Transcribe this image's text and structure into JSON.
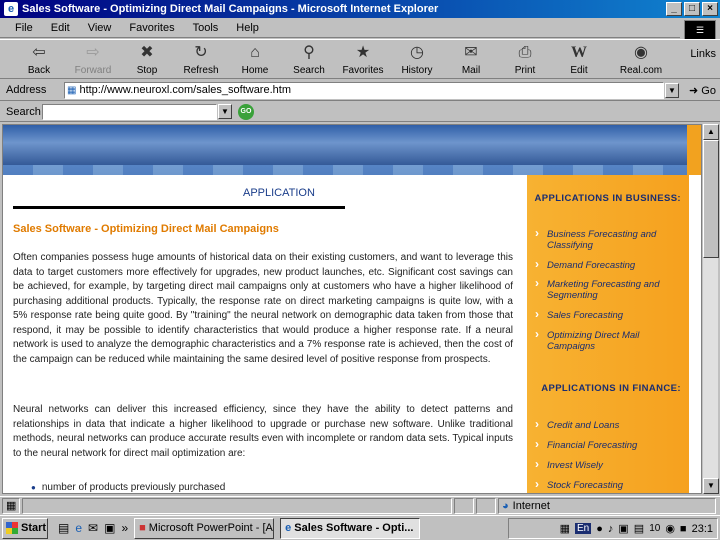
{
  "window": {
    "title": "Sales Software - Optimizing Direct Mail Campaigns - Microsoft Internet Explorer"
  },
  "menu": [
    "File",
    "Edit",
    "View",
    "Favorites",
    "Tools",
    "Help"
  ],
  "toolbar": {
    "back": "Back",
    "forward": "Forward",
    "stop": "Stop",
    "refresh": "Refresh",
    "home": "Home",
    "search": "Search",
    "favorites": "Favorites",
    "history": "History",
    "mail": "Mail",
    "print": "Print",
    "edit": "Edit",
    "realcom": "Real.com",
    "links": "Links"
  },
  "address": {
    "label": "Address",
    "url": "http://www.neuroxl.com/sales_software.htm",
    "go": "Go"
  },
  "searchbar": {
    "label": "Search",
    "go_badge": "GO"
  },
  "page": {
    "section_label": "APPLICATION",
    "heading": "Sales Software - Optimizing Direct Mail Campaigns",
    "p1": "Often companies possess huge amounts of historical data on their existing customers, and want to leverage this data to target customers more effectively for upgrades, new product launches, etc. Significant cost savings can be achieved, for example, by targeting direct mail campaigns only at customers who have a higher likelihood of purchasing additional products. Typically, the response rate on direct marketing campaigns is quite low, with a 5% response rate being quite good. By \"training\" the neural network on demographic data taken from those that respond, it may be possible to identify characteristics that would produce a higher response rate. If a neural network is used to analyze the demographic characteristics and a 7% response rate is achieved, then the cost of the campaign can be reduced while maintaining the same desired level of positive response from prospects.",
    "p2": "Neural networks can deliver this increased efficiency, since they have the ability to detect patterns and relationships in data that indicate a higher likelihood to upgrade or purchase new software. Unlike traditional methods, neural networks can produce accurate results even with incomplete or random data sets. Typical inputs to the neural network for direct mail optimization are:",
    "bullet1": "number of products previously purchased"
  },
  "sidebar": {
    "head_business": "APPLICATIONS IN BUSINESS:",
    "business_items": [
      "Business Forecasting and Classifying",
      "Demand Forecasting",
      "Marketing Forecasting and Segmenting",
      "Sales Forecasting",
      "Optimizing Direct Mail Campaigns"
    ],
    "head_finance": "APPLICATIONS IN FINANCE:",
    "finance_items": [
      "Credit and Loans",
      "Financial Forecasting",
      "Invest Wisely",
      "Stock Forecasting"
    ]
  },
  "status": {
    "zone": "Internet"
  },
  "taskbar": {
    "start": "Start",
    "tasks": [
      "Microsoft PowerPoint - [A]",
      "Sales Software - Opti..."
    ],
    "tray_badge": "En",
    "tray_page": "10",
    "clock": "23:1"
  }
}
